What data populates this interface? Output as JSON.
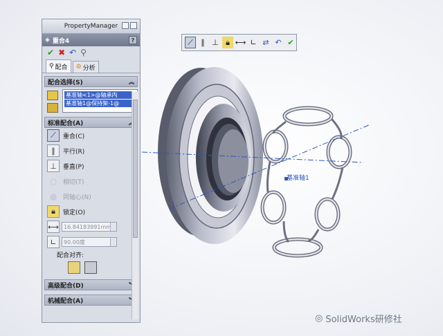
{
  "panel": {
    "title": "PropertyManager",
    "feature_name": "重合4",
    "help": "?",
    "tabs": [
      {
        "label": "配合"
      },
      {
        "label": "分析"
      }
    ]
  },
  "mate_selections": {
    "header": "配合选择(S)",
    "items": [
      "基准轴<1>@轴承内",
      "基准轴1@保持架-1@"
    ]
  },
  "standard_mates": {
    "header": "标准配合(A)",
    "items": [
      {
        "label": "重合(C)",
        "enabled": true,
        "selected": true,
        "icon": "coincident-icon"
      },
      {
        "label": "平行(R)",
        "enabled": true,
        "selected": false,
        "icon": "parallel-icon"
      },
      {
        "label": "垂直(P)",
        "enabled": true,
        "selected": false,
        "icon": "perpendicular-icon"
      },
      {
        "label": "相切(T)",
        "enabled": false,
        "selected": false,
        "icon": "tangent-icon"
      },
      {
        "label": "同轴心(N)",
        "enabled": false,
        "selected": false,
        "icon": "concentric-icon"
      },
      {
        "label": "锁定(O)",
        "enabled": true,
        "selected": false,
        "icon": "lock-icon"
      }
    ],
    "distance_value": "16.84183991mm",
    "angle_value": "90.00度",
    "alignment_label": "配合对齐:"
  },
  "advanced_mates": {
    "header": "高级配合(D)"
  },
  "mechanical_mates": {
    "header": "机械配合(A)"
  },
  "axis_label": "基准轴1",
  "watermark": "SolidWorks研修社",
  "colors": {
    "selection": "#3b63c9",
    "axis": "#2b56c0",
    "accept": "#2e9a2e",
    "cancel": "#cc2222"
  }
}
